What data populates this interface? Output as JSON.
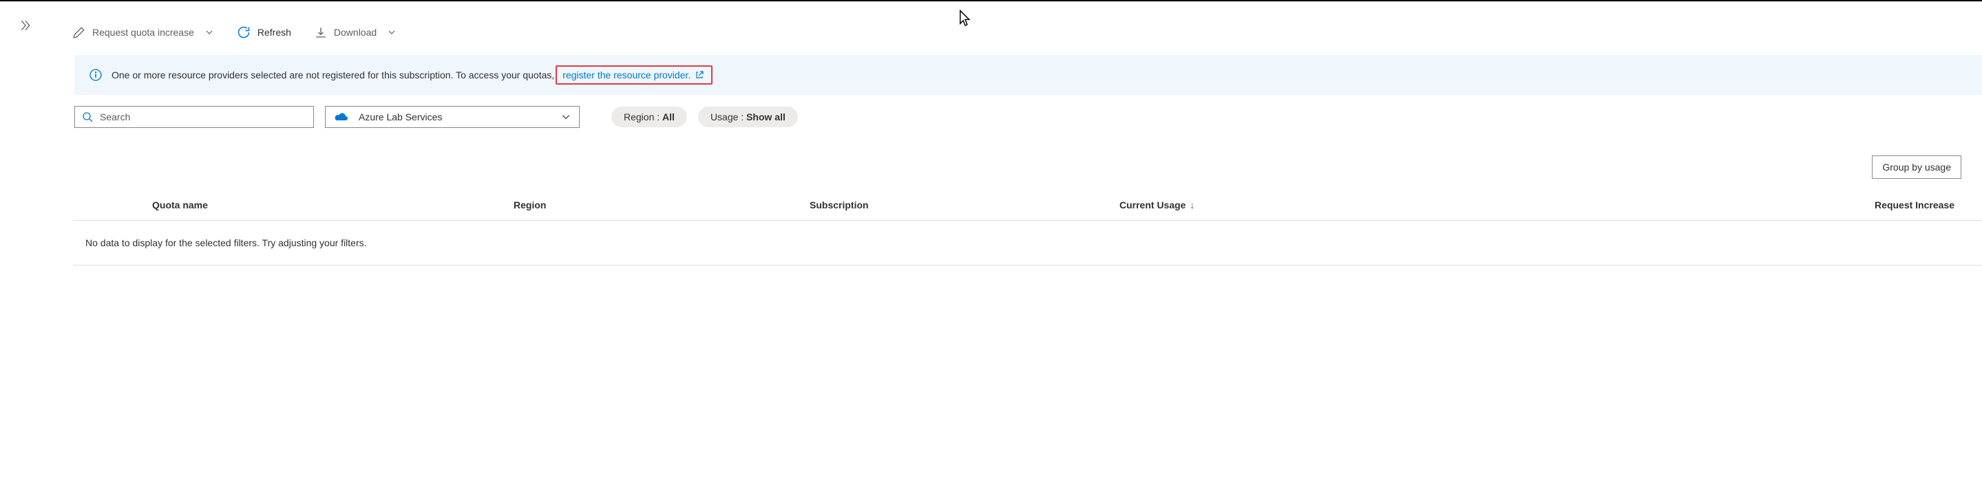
{
  "toolbar": {
    "request_increase": "Request quota increase",
    "refresh": "Refresh",
    "download": "Download"
  },
  "info": {
    "message": "One or more resource providers selected are not registered for this subscription. To access your quotas,",
    "link_text": "register the resource provider."
  },
  "filters": {
    "search_placeholder": "Search",
    "provider": "Azure Lab Services",
    "region_label": "Region :",
    "region_value": "All",
    "usage_label": "Usage :",
    "usage_value": "Show all"
  },
  "groupby": "Group by usage",
  "columns": {
    "quota": "Quota name",
    "region": "Region",
    "subscription": "Subscription",
    "usage": "Current Usage",
    "request": "Request Increase"
  },
  "empty_message": "No data to display for the selected filters. Try adjusting your filters."
}
